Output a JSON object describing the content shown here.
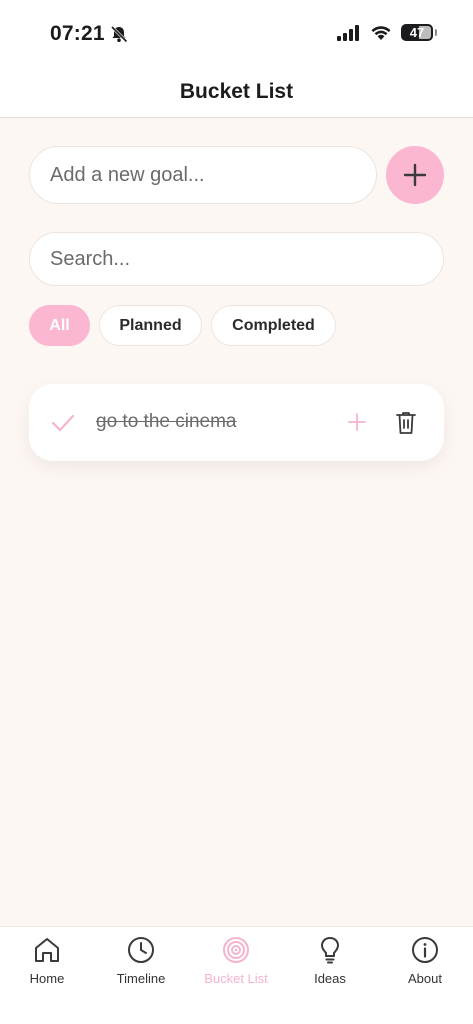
{
  "status_bar": {
    "time": "07:21",
    "battery_level": "47"
  },
  "header": {
    "title": "Bucket List"
  },
  "new_goal": {
    "placeholder": "Add a new goal..."
  },
  "search": {
    "placeholder": "Search..."
  },
  "filters": [
    {
      "label": "All",
      "active": true
    },
    {
      "label": "Planned",
      "active": false
    },
    {
      "label": "Completed",
      "active": false
    }
  ],
  "goals": [
    {
      "text": "go to the cinema",
      "completed": true
    }
  ],
  "tabs": [
    {
      "label": "Home",
      "icon": "home-icon",
      "active": false
    },
    {
      "label": "Timeline",
      "icon": "clock-icon",
      "active": false
    },
    {
      "label": "Bucket List",
      "icon": "target-icon",
      "active": true
    },
    {
      "label": "Ideas",
      "icon": "lightbulb-icon",
      "active": false
    },
    {
      "label": "About",
      "icon": "info-icon",
      "active": false
    }
  ],
  "colors": {
    "accent": "#fbb6d2",
    "background": "#fdf7f4",
    "text": "#1c1c1e"
  }
}
